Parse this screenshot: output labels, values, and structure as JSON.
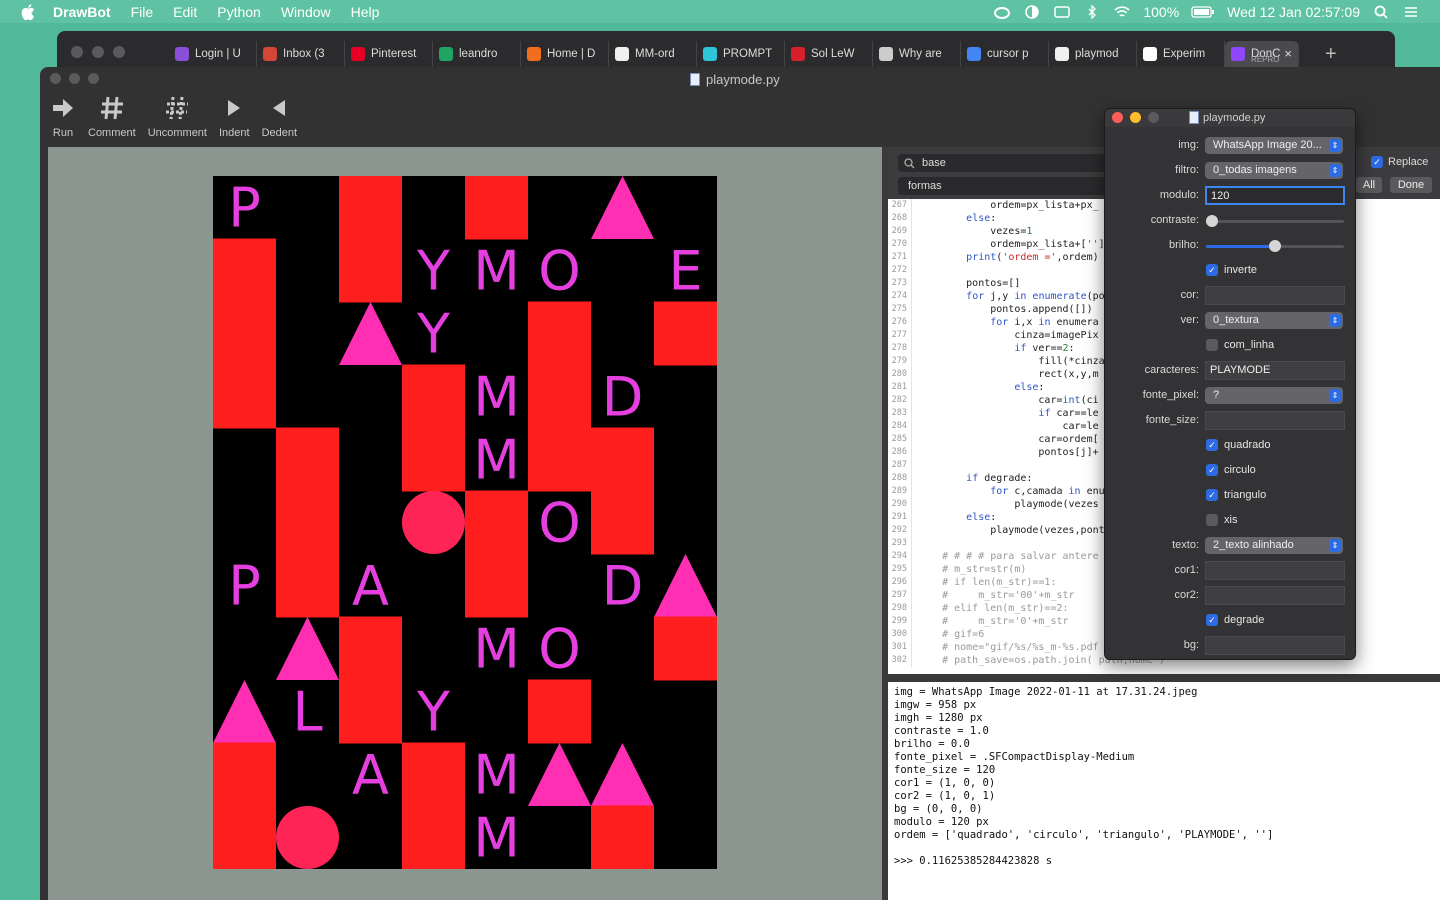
{
  "menubar": {
    "app": "DrawBot",
    "items": [
      "File",
      "Edit",
      "Python",
      "Window",
      "Help"
    ],
    "battery": "100%",
    "datetime": "Wed 12 Jan  02:57:09"
  },
  "browser": {
    "tabs": [
      {
        "label": "Login | U",
        "color": "#8a4fd8"
      },
      {
        "label": "Inbox (3",
        "color": "#d44638"
      },
      {
        "label": "Pinterest",
        "color": "#e60023"
      },
      {
        "label": "leandro",
        "color": "#1fa463"
      },
      {
        "label": "Home | D",
        "color": "#f26e1f"
      },
      {
        "label": "MM-ord",
        "color": "#f0f0f0"
      },
      {
        "label": "PROMPT",
        "color": "#2ec5d9"
      },
      {
        "label": "Sol LeW",
        "color": "#d6202a"
      },
      {
        "label": "Why are",
        "color": "#cccccc"
      },
      {
        "label": "cursor p",
        "color": "#4285f4"
      },
      {
        "label": "playmod",
        "color": "#f0f0f0"
      },
      {
        "label": "Experim",
        "color": "#ffffff"
      }
    ],
    "active_tab": {
      "label": "DonC",
      "sub": "REPRO",
      "color": "#9146ff"
    }
  },
  "drawbot": {
    "title": "playmode.py",
    "toolbar": [
      "Run",
      "Comment",
      "Uncomment",
      "Indent",
      "Dedent"
    ],
    "find": {
      "search": "base",
      "replace": "formas",
      "replace_label": "Replace",
      "all": "All",
      "done": "Done"
    },
    "code": [
      {
        "n": "267",
        "t": "            ordem=px_lista+px_"
      },
      {
        "n": "268",
        "t": "        else:"
      },
      {
        "n": "269",
        "t": "            vezes=1"
      },
      {
        "n": "270",
        "t": "            ordem=px_lista+['']"
      },
      {
        "n": "271",
        "t": "        print('ordem =',ordem)"
      },
      {
        "n": "272",
        "t": ""
      },
      {
        "n": "273",
        "t": "        pontos=[]"
      },
      {
        "n": "274",
        "t": "        for j,y in enumerate(po"
      },
      {
        "n": "275",
        "t": "            pontos.append([])"
      },
      {
        "n": "276",
        "t": "            for i,x in enumera"
      },
      {
        "n": "277",
        "t": "                cinza=imagePix"
      },
      {
        "n": "278",
        "t": "                if ver==2:"
      },
      {
        "n": "279",
        "t": "                    fill(*cinza"
      },
      {
        "n": "280",
        "t": "                    rect(x,y,m"
      },
      {
        "n": "281",
        "t": "                else:"
      },
      {
        "n": "282",
        "t": "                    car=int(ci"
      },
      {
        "n": "283",
        "t": "                    if car==le"
      },
      {
        "n": "284",
        "t": "                        car=le"
      },
      {
        "n": "285",
        "t": "                    car=ordem["
      },
      {
        "n": "286",
        "t": "                    pontos[j]+"
      },
      {
        "n": "287",
        "t": ""
      },
      {
        "n": "288",
        "t": "        if degrade:"
      },
      {
        "n": "289",
        "t": "            for c,camada in enu"
      },
      {
        "n": "290",
        "t": "                playmode(vezes"
      },
      {
        "n": "291",
        "t": "        else:"
      },
      {
        "n": "292",
        "t": "            playmode(vezes,pont"
      },
      {
        "n": "293",
        "t": ""
      },
      {
        "n": "294",
        "t": "    # # # # para salvar antere"
      },
      {
        "n": "295",
        "t": "    # m_str=str(m)"
      },
      {
        "n": "296",
        "t": "    # if len(m_str)==1:"
      },
      {
        "n": "297",
        "t": "    #     m_str='00'+m_str"
      },
      {
        "n": "298",
        "t": "    # elif len(m_str)==2:"
      },
      {
        "n": "299",
        "t": "    #     m_str='0'+m_str"
      },
      {
        "n": "300",
        "t": "    # gif=6"
      },
      {
        "n": "301",
        "t": "    # nome=\"gif/%s/%s_m-%s.pdf"
      },
      {
        "n": "302",
        "t": "    # path_save=os.path.join( path,nome )"
      }
    ],
    "console": [
      "img = WhatsApp Image 2022-01-11 at 17.31.24.jpeg",
      "imgw = 958 px",
      "imgh = 1280 px",
      "contraste = 1.0",
      "brilho = 0.0",
      "fonte_pixel = .SFCompactDisplay-Medium",
      "fonte_size = 120",
      "cor1 = (1, 0, 0)",
      "cor2 = (1, 0, 1)",
      "bg = (0, 0, 0)",
      "modulo = 120 px",
      "ordem = ['quadrado', 'circulo', 'triangulo', 'PLAYMODE', '']",
      "",
      ">>> 0.11625385284423828 s"
    ]
  },
  "panel": {
    "title": "playmode.py",
    "rows": [
      {
        "label": "img:",
        "type": "select",
        "value": "WhatsApp Image 20..."
      },
      {
        "label": "filtro:",
        "type": "select",
        "value": "0_todas imagens"
      },
      {
        "label": "modulo:",
        "type": "text",
        "value": "120",
        "focus": true
      },
      {
        "label": "contraste:",
        "type": "slider",
        "value": 0.0
      },
      {
        "label": "brilho:",
        "type": "slider",
        "value": 0.5
      },
      {
        "label": "",
        "type": "check",
        "value": "inverte",
        "checked": true
      },
      {
        "label": "cor:",
        "type": "text",
        "value": ""
      },
      {
        "label": "ver:",
        "type": "select",
        "value": "0_textura"
      },
      {
        "label": "",
        "type": "check",
        "value": "com_linha",
        "checked": false
      },
      {
        "label": "caracteres:",
        "type": "text",
        "value": "PLAYMODE"
      },
      {
        "label": "fonte_pixel:",
        "type": "select",
        "value": "?"
      },
      {
        "label": "fonte_size:",
        "type": "text",
        "value": ""
      },
      {
        "label": "",
        "type": "check",
        "value": "quadrado",
        "checked": true
      },
      {
        "label": "",
        "type": "check",
        "value": "circulo",
        "checked": true
      },
      {
        "label": "",
        "type": "check",
        "value": "triangulo",
        "checked": true
      },
      {
        "label": "",
        "type": "check",
        "value": "xis",
        "checked": false
      },
      {
        "label": "texto:",
        "type": "select",
        "value": "2_texto alinhado"
      },
      {
        "label": "cor1:",
        "type": "text",
        "value": ""
      },
      {
        "label": "cor2:",
        "type": "text",
        "value": ""
      },
      {
        "label": "",
        "type": "check",
        "value": "degrade",
        "checked": true
      },
      {
        "label": "bg:",
        "type": "text",
        "value": ""
      }
    ]
  },
  "poster": {
    "colors": {
      "bg": "#000000",
      "red": "#ff1e1e",
      "magenta": "#ff2fb3",
      "circle": "#ff2456",
      "text": "#e63fe0"
    },
    "cols": 8,
    "rows": 11,
    "cells": [
      {
        "c": 0,
        "r": 0,
        "k": "t",
        "v": "P"
      },
      {
        "c": 2,
        "r": 0,
        "k": "q"
      },
      {
        "c": 4,
        "r": 0,
        "k": "q"
      },
      {
        "c": 6,
        "r": 0,
        "k": "tri"
      },
      {
        "c": 0,
        "r": 1,
        "k": "q"
      },
      {
        "c": 2,
        "r": 1,
        "k": "q"
      },
      {
        "c": 3,
        "r": 1,
        "k": "t",
        "v": "Y"
      },
      {
        "c": 4,
        "r": 1,
        "k": "t",
        "v": "M"
      },
      {
        "c": 5,
        "r": 1,
        "k": "t",
        "v": "O"
      },
      {
        "c": 7,
        "r": 1,
        "k": "t",
        "v": "E"
      },
      {
        "c": 0,
        "r": 2,
        "k": "q"
      },
      {
        "c": 2,
        "r": 2,
        "k": "tri"
      },
      {
        "c": 3,
        "r": 2,
        "k": "t",
        "v": "Y"
      },
      {
        "c": 5,
        "r": 2,
        "k": "q"
      },
      {
        "c": 7,
        "r": 2,
        "k": "q"
      },
      {
        "c": 0,
        "r": 3,
        "k": "q"
      },
      {
        "c": 3,
        "r": 3,
        "k": "q"
      },
      {
        "c": 4,
        "r": 3,
        "k": "t",
        "v": "M"
      },
      {
        "c": 5,
        "r": 3,
        "k": "q"
      },
      {
        "c": 6,
        "r": 3,
        "k": "t",
        "v": "D"
      },
      {
        "c": 1,
        "r": 4,
        "k": "q"
      },
      {
        "c": 3,
        "r": 4,
        "k": "q"
      },
      {
        "c": 4,
        "r": 4,
        "k": "t",
        "v": "M"
      },
      {
        "c": 5,
        "r": 4,
        "k": "q"
      },
      {
        "c": 6,
        "r": 4,
        "k": "q"
      },
      {
        "c": 1,
        "r": 5,
        "k": "q"
      },
      {
        "c": 3,
        "r": 5,
        "k": "c"
      },
      {
        "c": 4,
        "r": 5,
        "k": "q"
      },
      {
        "c": 5,
        "r": 5,
        "k": "t",
        "v": "O"
      },
      {
        "c": 6,
        "r": 5,
        "k": "q"
      },
      {
        "c": 0,
        "r": 6,
        "k": "t",
        "v": "P"
      },
      {
        "c": 1,
        "r": 6,
        "k": "q"
      },
      {
        "c": 2,
        "r": 6,
        "k": "t",
        "v": "A"
      },
      {
        "c": 4,
        "r": 6,
        "k": "q"
      },
      {
        "c": 6,
        "r": 6,
        "k": "t",
        "v": "D"
      },
      {
        "c": 7,
        "r": 6,
        "k": "tri"
      },
      {
        "c": 1,
        "r": 7,
        "k": "tri"
      },
      {
        "c": 2,
        "r": 7,
        "k": "q"
      },
      {
        "c": 4,
        "r": 7,
        "k": "t",
        "v": "M"
      },
      {
        "c": 5,
        "r": 7,
        "k": "t",
        "v": "O"
      },
      {
        "c": 7,
        "r": 7,
        "k": "q"
      },
      {
        "c": 0,
        "r": 8,
        "k": "tri"
      },
      {
        "c": 1,
        "r": 8,
        "k": "t",
        "v": "L"
      },
      {
        "c": 2,
        "r": 8,
        "k": "q"
      },
      {
        "c": 3,
        "r": 8,
        "k": "t",
        "v": "Y"
      },
      {
        "c": 5,
        "r": 8,
        "k": "q"
      },
      {
        "c": 0,
        "r": 9,
        "k": "q"
      },
      {
        "c": 2,
        "r": 9,
        "k": "t",
        "v": "A"
      },
      {
        "c": 3,
        "r": 9,
        "k": "q"
      },
      {
        "c": 4,
        "r": 9,
        "k": "t",
        "v": "M"
      },
      {
        "c": 5,
        "r": 9,
        "k": "tri"
      },
      {
        "c": 6,
        "r": 9,
        "k": "tri"
      },
      {
        "c": 0,
        "r": 10,
        "k": "q"
      },
      {
        "c": 1,
        "r": 10,
        "k": "c"
      },
      {
        "c": 3,
        "r": 10,
        "k": "q"
      },
      {
        "c": 4,
        "r": 10,
        "k": "t",
        "v": "M"
      },
      {
        "c": 6,
        "r": 10,
        "k": "q"
      }
    ]
  }
}
